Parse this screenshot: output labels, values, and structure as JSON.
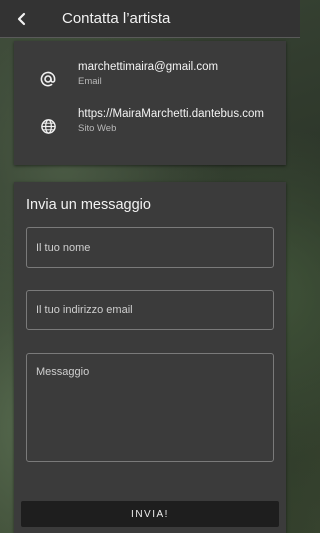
{
  "appbar": {
    "title": "Contatta l’artista",
    "back_icon": "arrow-left-icon"
  },
  "contacts": [
    {
      "icon": "at-sign-icon",
      "value": "marchettimaira@gmail.com",
      "label": "Email"
    },
    {
      "icon": "globe-icon",
      "value": "https://MairaMarchetti.dantebus.com",
      "label": "Sito Web"
    }
  ],
  "form": {
    "title": "Invia un messaggio",
    "name_placeholder": "Il tuo nome",
    "email_placeholder": "Il tuo indirizzo email",
    "message_placeholder": "Messaggio",
    "submit_label": "INVIA!"
  }
}
